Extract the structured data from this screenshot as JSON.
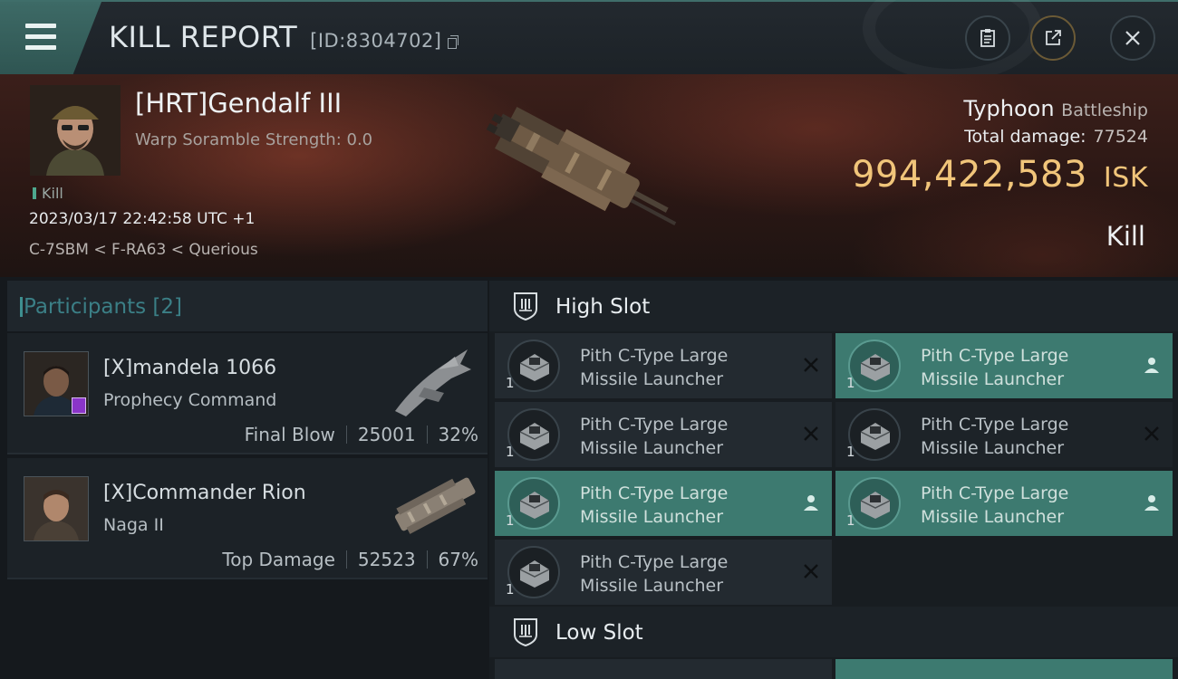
{
  "header": {
    "title": "KILL REPORT",
    "report_id": "[ID:8304702]"
  },
  "victim": {
    "name": "[HRT]Gendalf III",
    "warp_scramble": "Warp Soramble Strength: 0.0",
    "tag": "Kill",
    "datetime": "2023/03/17 22:42:58 UTC +1",
    "location": "C-7SBM < F-RA63 < Querious",
    "ship_name": "Typhoon",
    "ship_class": "Battleship",
    "total_damage_label": "Total damage:",
    "total_damage": "77524",
    "isk_value": "994,422,583",
    "isk_unit": "ISK",
    "status": "Kill"
  },
  "participants": {
    "label": "Participants",
    "count": "[2]",
    "list": [
      {
        "name": "[X]mandela 1066",
        "ship": "Prophecy Command",
        "role": "Final Blow",
        "damage": "25001",
        "percent": "32%"
      },
      {
        "name": "[X]Commander Rion",
        "ship": "Naga II",
        "role": "Top Damage",
        "damage": "52523",
        "percent": "67%"
      }
    ]
  },
  "slots": {
    "high_label": "High Slot",
    "low_label": "Low Slot",
    "high_items": [
      {
        "line1": "Pith C-Type Large",
        "line2": "Missile Launcher",
        "qty": "1",
        "state": "destroyed"
      },
      {
        "line1": "Pith C-Type Large",
        "line2": "Missile Launcher",
        "qty": "1",
        "state": "dropped"
      },
      {
        "line1": "Pith C-Type Large",
        "line2": "Missile Launcher",
        "qty": "1",
        "state": "destroyed"
      },
      {
        "line1": "Pith C-Type Large",
        "line2": "Missile Launcher",
        "qty": "1",
        "state": "destroyed"
      },
      {
        "line1": "Pith C-Type Large",
        "line2": "Missile Launcher",
        "qty": "1",
        "state": "dropped"
      },
      {
        "line1": "Pith C-Type Large",
        "line2": "Missile Launcher",
        "qty": "1",
        "state": "dropped"
      },
      {
        "line1": "Pith C-Type Large",
        "line2": "Missile Launcher",
        "qty": "1",
        "state": "destroyed"
      }
    ]
  },
  "colors": {
    "accent_teal": "#3d7a70",
    "isk_gold": "#f1c57a",
    "participants_label": "#3b7f86"
  },
  "icons": [
    "menu-icon",
    "copy-icon",
    "clipboard-icon",
    "share-icon",
    "close-icon",
    "shield-icon",
    "destroyed-x-icon",
    "dropped-person-icon"
  ]
}
